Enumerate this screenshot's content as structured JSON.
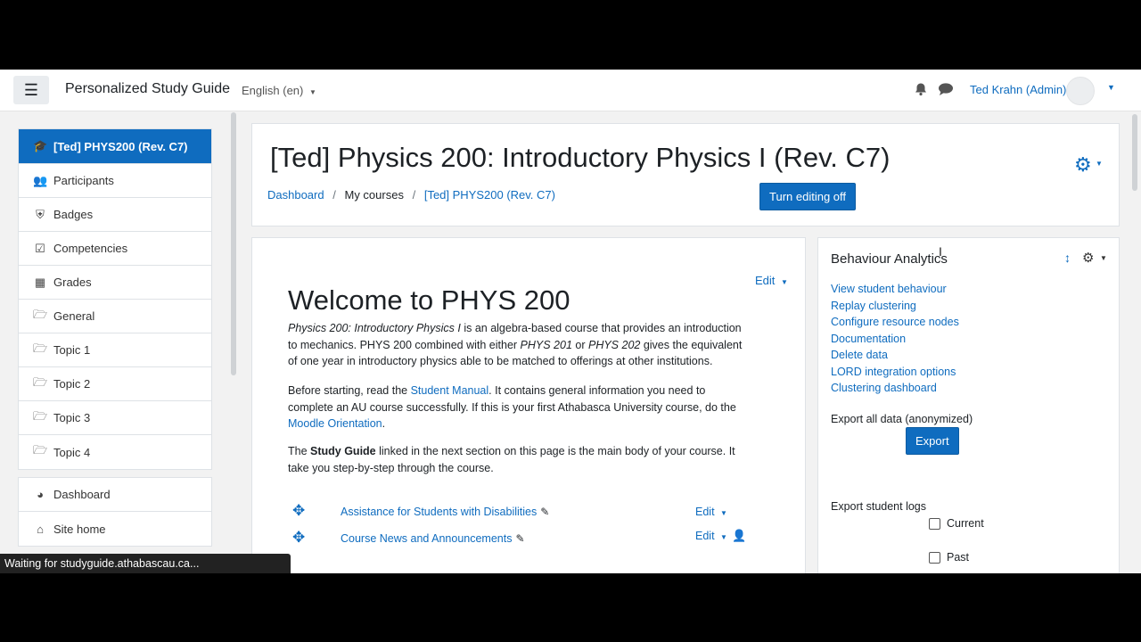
{
  "topbar": {
    "site_name": "Personalized Study Guide",
    "language": "English (en)",
    "user_name": "Ted Krahn (Admin)"
  },
  "nav": {
    "items": [
      {
        "label": "[Ted] PHYS200 (Rev. C7)",
        "icon": "graduation-cap-icon"
      },
      {
        "label": "Participants",
        "icon": "users-icon"
      },
      {
        "label": "Badges",
        "icon": "shield-icon"
      },
      {
        "label": "Competencies",
        "icon": "checkbox-icon"
      },
      {
        "label": "Grades",
        "icon": "table-icon"
      },
      {
        "label": "General",
        "icon": "folder-icon"
      },
      {
        "label": "Topic 1",
        "icon": "folder-icon"
      },
      {
        "label": "Topic 2",
        "icon": "folder-icon"
      },
      {
        "label": "Topic 3",
        "icon": "folder-icon"
      },
      {
        "label": "Topic 4",
        "icon": "folder-icon"
      }
    ],
    "second": [
      {
        "label": "Dashboard",
        "icon": "dashboard-icon"
      },
      {
        "label": "Site home",
        "icon": "home-icon"
      }
    ]
  },
  "header": {
    "title": "[Ted] Physics 200: Introductory Physics I (Rev. C7)",
    "breadcrumb": [
      "Dashboard",
      "My courses",
      "[Ted] PHYS200 (Rev. C7)"
    ],
    "turn_editing": "Turn editing off"
  },
  "main": {
    "edit": "Edit",
    "welcome": "Welcome to PHYS 200",
    "p1_em1": "Physics 200: Introductory Physics I",
    "p1_a": " is an algebra-based course that provides an introduction to mechanics. PHYS 200 combined with either ",
    "p1_em2": "PHYS 201",
    "p1_b": " or ",
    "p1_em3": "PHYS 202",
    "p1_c": " gives the equivalent of one year in introductory physics able to be matched to offerings at other institutions.",
    "p2_a": "Before starting, read the ",
    "p2_link1": "Student Manual",
    "p2_b": ". It contains general information you need to complete an AU course successfully. If this is your first Athabasca University course, do the ",
    "p2_link2": "Moodle Orientation",
    "p2_c": ".",
    "p3_a": "The ",
    "p3_strong": "Study Guide",
    "p3_b": " linked in the next section on this page is the main body of your course. It take you step-by-step through the course.",
    "activities": [
      {
        "label": "Assistance for Students with Disabilities",
        "edit": "Edit"
      },
      {
        "label": "Course News and Announcements",
        "edit": "Edit"
      }
    ]
  },
  "block": {
    "title": "Behaviour Analytics",
    "links": [
      "View student behaviour",
      "Replay clustering",
      "Configure resource nodes",
      "Documentation",
      "Delete data",
      "LORD integration options",
      "Clustering dashboard"
    ],
    "export_all_label": "Export all data (anonymized)",
    "export_button": "Export",
    "export_logs_label": "Export student logs",
    "checkboxes": [
      "Current",
      "Past"
    ]
  },
  "status_bar": "Waiting for studyguide.athabascau.ca..."
}
